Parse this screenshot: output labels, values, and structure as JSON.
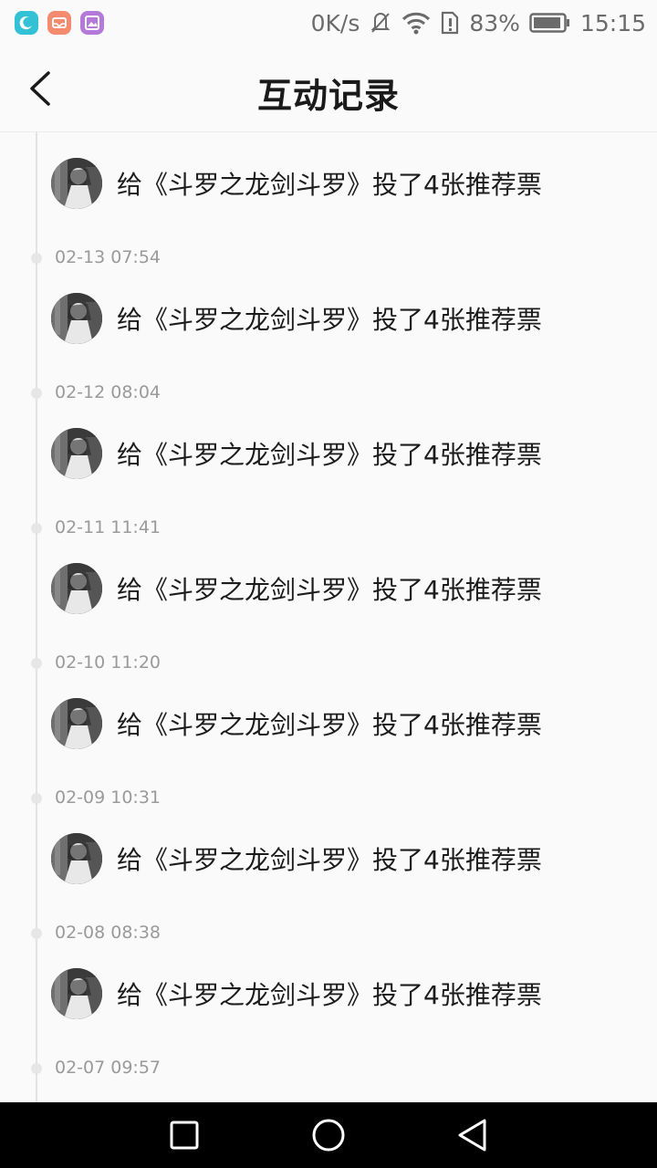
{
  "status_bar": {
    "net_speed": "0K/s",
    "battery": "83%",
    "time": "15:15",
    "icons": [
      "moon-app-icon",
      "mail-app-icon",
      "gallery-app-icon",
      "mute-icon",
      "wifi-icon",
      "sim-alert-icon",
      "battery-icon"
    ]
  },
  "header": {
    "title": "互动记录",
    "back_icon": "chevron-left-icon"
  },
  "records": [
    {
      "text": "给《斗罗之龙剑斗罗》投了4张推荐票",
      "date": "02-13 07:54"
    },
    {
      "text": "给《斗罗之龙剑斗罗》投了4张推荐票",
      "date": "02-12 08:04"
    },
    {
      "text": "给《斗罗之龙剑斗罗》投了4张推荐票",
      "date": "02-11 11:41"
    },
    {
      "text": "给《斗罗之龙剑斗罗》投了4张推荐票",
      "date": "02-10 11:20"
    },
    {
      "text": "给《斗罗之龙剑斗罗》投了4张推荐票",
      "date": "02-09 10:31"
    },
    {
      "text": "给《斗罗之龙剑斗罗》投了4张推荐票",
      "date": "02-08 08:38"
    },
    {
      "text": "给《斗罗之龙剑斗罗》投了4张推荐票",
      "date": "02-07 09:57"
    }
  ],
  "nav_bar": {
    "icons": [
      "recent-apps-icon",
      "home-icon",
      "back-icon"
    ]
  },
  "colors": {
    "background": "#fafafa",
    "title_text": "#1a1a1a",
    "date_text": "#9a9a9a",
    "timeline": "#e3e3e3",
    "nav_bar": "#000000"
  }
}
